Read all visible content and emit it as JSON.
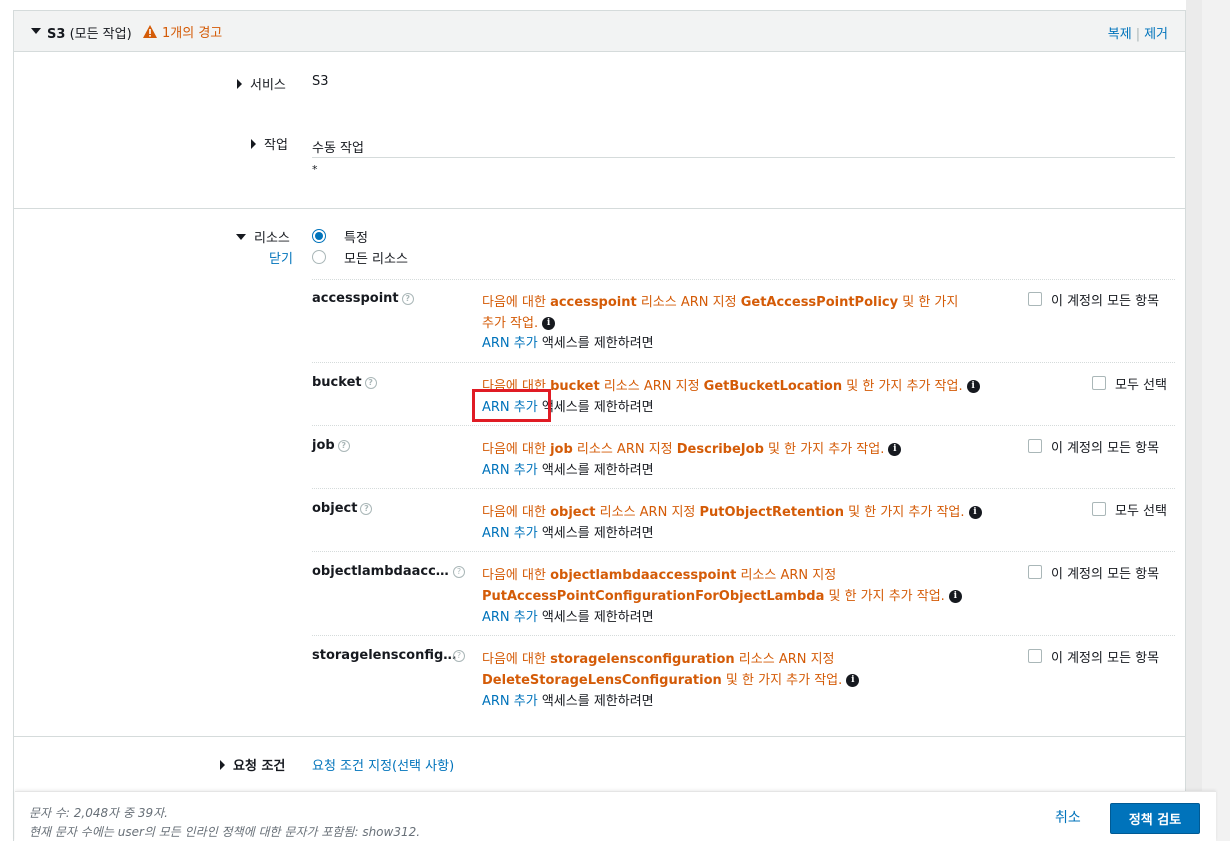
{
  "header": {
    "service_bold": "S3",
    "service_suffix": "(모든 작업)",
    "warning": "1개의 경고",
    "copy": "복제",
    "remove": "제거"
  },
  "service": {
    "label": "서비스",
    "value": "S3"
  },
  "actions": {
    "label": "작업",
    "title": "수동 작업",
    "value": "*"
  },
  "resources": {
    "label": "리소스",
    "close": "닫기",
    "options": [
      "특정",
      "모든 리소스"
    ],
    "selected": "특정",
    "add_arn": "ARN 추가",
    "restrict_suffix": "액세스를 제한하려면",
    "items": [
      {
        "name": "accesspoint",
        "line1_pre": "다음에 대한 ",
        "resource": "accesspoint",
        "line1_mid": " 리소스 ARN 지정 ",
        "action": "GetAccessPointPolicy",
        "line1_post": " 및 한 가지",
        "line2": "추가 작업.",
        "checkbox_label": "이 계정의 모든 항목"
      },
      {
        "name": "bucket",
        "line1_pre": "다음에 대한 ",
        "resource": "bucket",
        "line1_mid": " 리소스 ARN 지정 ",
        "action": "GetBucketLocation",
        "line1_post": " 및 한 가지 추가 작업.",
        "checkbox_label": "모두 선택"
      },
      {
        "name": "job",
        "line1_pre": "다음에 대한 ",
        "resource": "job",
        "line1_mid": " 리소스 ARN 지정 ",
        "action": "DescribeJob",
        "line1_post": " 및 한 가지 추가 작업.",
        "checkbox_label": "이 계정의 모든 항목"
      },
      {
        "name": "object",
        "line1_pre": "다음에 대한 ",
        "resource": "object",
        "line1_mid": " 리소스 ARN 지정 ",
        "action": "PutObjectRetention",
        "line1_post": " 및 한 가지 추가 작업.",
        "checkbox_label": "모두 선택"
      },
      {
        "name": "objectlambdaacc…",
        "line1_pre": "다음에 대한 ",
        "resource": "objectlambdaaccesspoint",
        "line1_mid": " 리소스 ARN 지정",
        "action": "PutAccessPointConfigurationForObjectLambda",
        "line2_post": " 및 한 가지 추가 작업.",
        "checkbox_label": "이 계정의 모든 항목"
      },
      {
        "name": "storagelensconfig…",
        "line1_pre": "다음에 대한 ",
        "resource": "storagelensconfiguration",
        "line1_mid": " 리소스 ARN 지정",
        "action": "DeleteStorageLensConfiguration",
        "line2_post": " 및 한 가지 추가 작업.",
        "checkbox_label": "이 계정의 모든 항목"
      }
    ]
  },
  "request_conditions": {
    "label": "요청 조건",
    "link": "요청 조건 지정(선택 사항)"
  },
  "footer": {
    "char_count": "문자 수: 2,048자 중 39자.",
    "note": "현재 문자 수에는 user의 모든 인라인 정책에 대한 문자가 포함됨: show312.",
    "cancel": "취소",
    "review": "정책 검토"
  }
}
